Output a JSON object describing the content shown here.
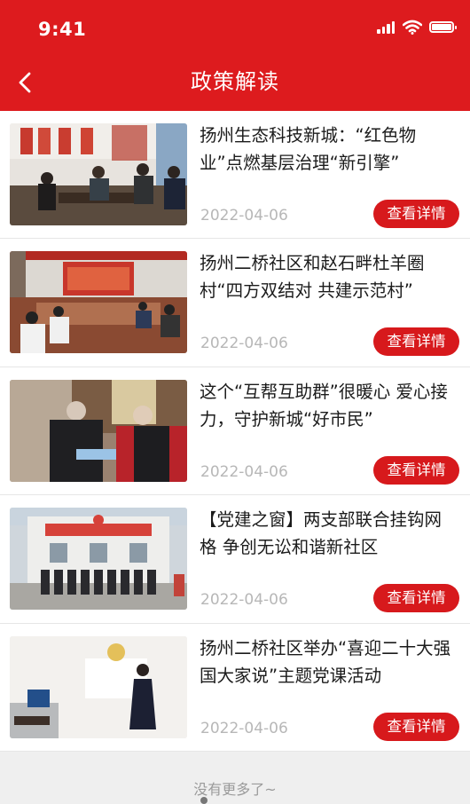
{
  "status": {
    "time": "9:41"
  },
  "header": {
    "title": "政策解读",
    "back_icon": "chevron-left-icon"
  },
  "detail_label": "查看详情",
  "articles": [
    {
      "title": "扬州生态科技新城：“红色物业”点燃基层治理“新引擎”",
      "date": "2022-04-06"
    },
    {
      "title": "扬州二桥社区和赵石畔杜羊圈村“四方双结对 共建示范村”",
      "date": "2022-04-06"
    },
    {
      "title": "这个“互帮互助群”很暖心 爱心接力，守护新城“好市民”",
      "date": "2022-04-06"
    },
    {
      "title": "【党建之窗】两支部联合挂钩网格 争创无讼和谐新社区",
      "date": "2022-04-06"
    },
    {
      "title": "扬州二桥社区举办“喜迎二十大强国大家说”主题党课活动",
      "date": "2022-04-06"
    }
  ],
  "footer": {
    "no_more": "没有更多了~"
  },
  "colors": {
    "brand_red": "#dd1b1e",
    "button_red": "#d7191c"
  }
}
